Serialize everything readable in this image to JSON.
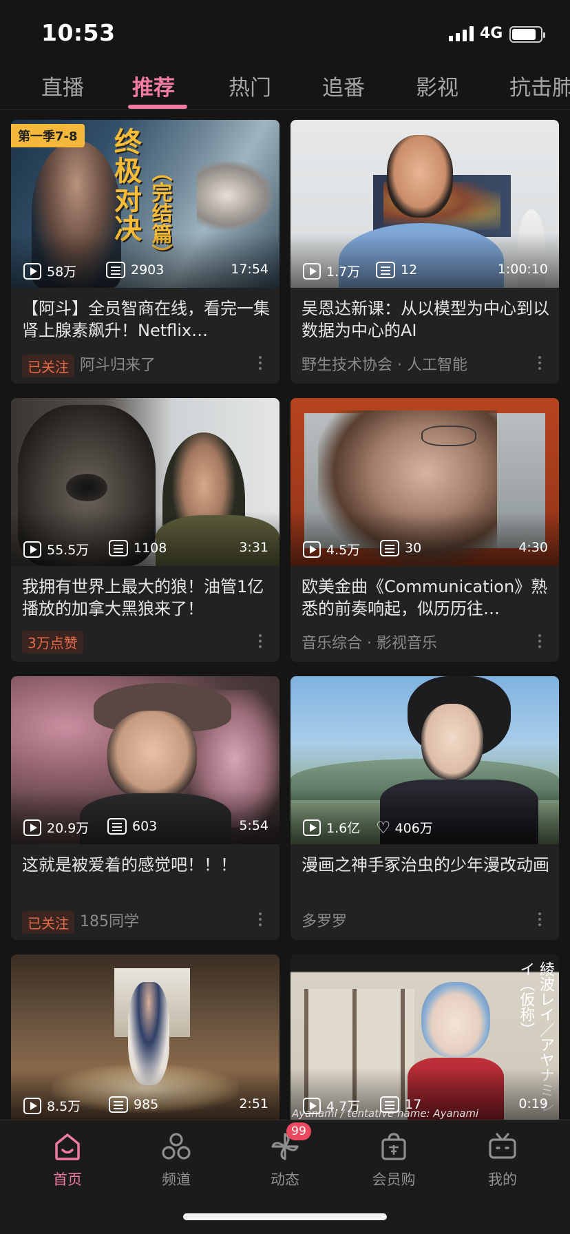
{
  "status_bar": {
    "time": "10:53",
    "network": "4G"
  },
  "tabs": [
    {
      "label": "直播",
      "active": false
    },
    {
      "label": "推荐",
      "active": true
    },
    {
      "label": "热门",
      "active": false
    },
    {
      "label": "追番",
      "active": false
    },
    {
      "label": "影视",
      "active": false
    },
    {
      "label": "抗击肺",
      "active": false
    }
  ],
  "cards": [
    {
      "views": "58万",
      "danmaku": "2903",
      "duration": "17:54",
      "title": "【阿斗】全员智商在线，看完一集肾上腺素飙升！Netflix…",
      "badge": "已关注",
      "author": "阿斗归来了",
      "cover": {
        "season": "第一季7-8",
        "line1": "终极对决",
        "line2": "（完结篇）"
      }
    },
    {
      "views": "1.7万",
      "danmaku": "12",
      "duration": "1:00:10",
      "title": "吴恩达新课：从以模型为中心到以数据为中心的AI",
      "badge": "",
      "author": "野生技术协会 · 人工智能"
    },
    {
      "views": "55.5万",
      "danmaku": "1108",
      "duration": "3:31",
      "title": "我拥有世界上最大的狼！油管1亿播放的加拿大黑狼来了！",
      "badge": "3万点赞",
      "author": ""
    },
    {
      "views": "4.5万",
      "danmaku": "30",
      "duration": "4:30",
      "title": "欧美金曲《Communication》熟悉的前奏响起，似历历往…",
      "badge": "",
      "author": "音乐综合 · 影视音乐"
    },
    {
      "views": "20.9万",
      "danmaku": "603",
      "duration": "5:54",
      "title": "这就是被爱着的感觉吧！！！",
      "badge": "已关注",
      "author": "185同学"
    },
    {
      "views": "1.6亿",
      "likes": "406万",
      "duration": "",
      "title": "漫画之神手冢治虫的少年漫改动画",
      "badge": "",
      "author": "多罗罗"
    },
    {
      "views": "8.5万",
      "danmaku": "985",
      "duration": "2:51",
      "title": "",
      "badge": "",
      "author": ""
    },
    {
      "views": "4.7万",
      "danmaku": "17",
      "duration": "0:19",
      "title": "",
      "badge": "",
      "author": "",
      "cover": {
        "side": "綾波レイ／アヤナミレイ（仮称）",
        "caption": "Ayanami / tentative name: Ayanami"
      }
    }
  ],
  "bottom_nav": [
    {
      "label": "首页",
      "icon": "home-icon",
      "active": true
    },
    {
      "label": "频道",
      "icon": "channel-icon",
      "active": false
    },
    {
      "label": "动态",
      "icon": "pinwheel-icon",
      "active": false,
      "badge": "99"
    },
    {
      "label": "会员购",
      "icon": "shopping-bag-icon",
      "active": false
    },
    {
      "label": "我的",
      "icon": "tv-icon",
      "active": false
    }
  ],
  "colors": {
    "accent": "#f07ba0",
    "badge_text": "#e46a4a",
    "background": "#151515",
    "card": "#222222"
  }
}
